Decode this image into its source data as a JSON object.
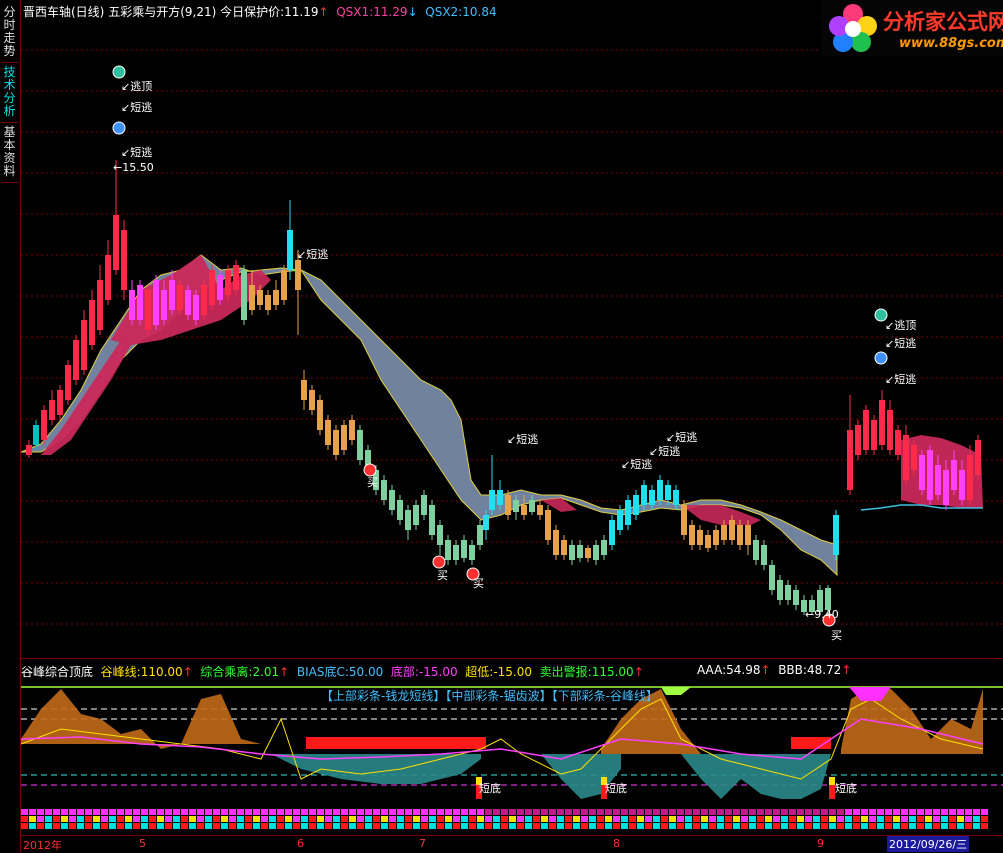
{
  "side_tabs": [
    "分时走势",
    "技术分析",
    "基本资料"
  ],
  "main_header": {
    "title": "晋西车轴(日线)",
    "indicator": "五彩乘与开方(9,21)",
    "protect_label": "今日保护价:",
    "protect_value": "11.19",
    "qsx1_label": "QSX1:",
    "qsx1_value": "11.29",
    "qsx2_label": "QSX2:",
    "qsx2_value": "10.84"
  },
  "logo": {
    "title": "分析家公式网",
    "url": "www.88gs.com"
  },
  "signals": {
    "escape_top": "逃顶",
    "short_escape": "短逃",
    "buy": "买",
    "bottom_short": "短底",
    "high_price": "15.50",
    "low_price": "9.40"
  },
  "sub_header": {
    "name": "谷峰综合顶底",
    "peak_label": "谷峰线:",
    "peak_value": "110.00",
    "comp_label": "综合乘离:",
    "comp_value": "2.01",
    "bias_label": "BIAS底C:",
    "bias_value": "50.00",
    "bottom_label": "底部:",
    "bottom_value": "-15.00",
    "super_low_label": "超低:",
    "super_low_value": "-15.00",
    "sell_label": "卖出警报:",
    "sell_value": "115.00",
    "aaa_label": "AAA:",
    "aaa_value": "54.98",
    "bbb_label": "BBB:",
    "bbb_value": "48.72"
  },
  "sub_legend": "【上部彩条-钱龙短线】【中部彩条-锯齿波】【下部彩条-谷峰线】",
  "x_axis": [
    "2012年",
    "5",
    "6",
    "7",
    "8",
    "9"
  ],
  "x_date": "2012/09/26/三",
  "colors": {
    "up": "#ff2a4a",
    "down": "#00c0c0",
    "gold": "#e6a24a",
    "green": "#7ed0a0",
    "cloud_red": "#c8285a",
    "cloud_blue": "#7d90b0",
    "grid": "#7a0000"
  }
}
